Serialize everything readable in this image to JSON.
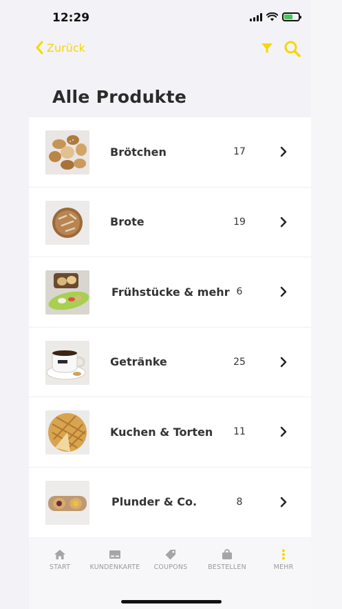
{
  "status_bar": {
    "time": "12:29",
    "battery_color": "#47c45a"
  },
  "nav": {
    "back_label": "Zurück",
    "accent_color": "#f5d800",
    "back_icon": "chevron-left-icon",
    "filter_icon": "filter-icon",
    "search_icon": "search-icon"
  },
  "page": {
    "title": "Alle Produkte"
  },
  "categories": [
    {
      "label": "Brötchen",
      "count": "17",
      "thumb": "bread-rolls-image"
    },
    {
      "label": "Brote",
      "count": "19",
      "thumb": "bread-loaf-image"
    },
    {
      "label": "Frühstücke & mehr",
      "count": "6",
      "thumb": "breakfast-image"
    },
    {
      "label": "Getränke",
      "count": "25",
      "thumb": "coffee-cup-image"
    },
    {
      "label": "Kuchen & Torten",
      "count": "11",
      "thumb": "cake-image"
    },
    {
      "label": "Plunder & Co.",
      "count": "8",
      "thumb": "pastry-image"
    }
  ],
  "tab_bar": {
    "tabs": [
      {
        "label": "START",
        "icon": "home-icon"
      },
      {
        "label": "KUNDENKARTE",
        "icon": "card-icon"
      },
      {
        "label": "COUPONS",
        "icon": "tag-icon"
      },
      {
        "label": "BESTELLEN",
        "icon": "bag-icon"
      },
      {
        "label": "MEHR",
        "icon": "more-icon",
        "active": true
      }
    ]
  }
}
